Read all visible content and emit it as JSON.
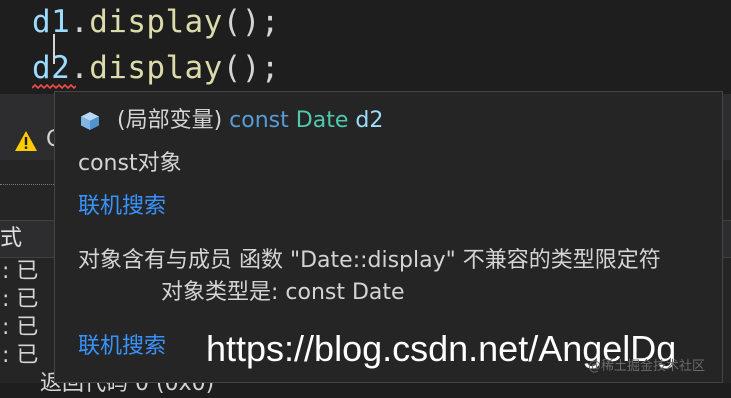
{
  "editor": {
    "line1": {
      "var": "d1",
      "dot": ".",
      "fn": "display",
      "tail": "();"
    },
    "line2": {
      "var": "d2",
      "dot": ".",
      "fn": "display",
      "tail": "();"
    }
  },
  "panel": {
    "warning_text": "C",
    "column_header": "式",
    "output_lines": [
      ": 已",
      ": 已",
      ": 已",
      ": 已"
    ],
    "bottom_line": "返回代码 0 (0x0)"
  },
  "tooltip": {
    "icon": "field-variable-icon",
    "signature": {
      "prefix": "(局部变量)",
      "keyword": "const",
      "type": "Date",
      "name": "d2"
    },
    "description": "const对象",
    "link1": "联机搜索",
    "error_line1": "对象含有与成员 函数 \"Date::display\" 不兼容的类型限定符",
    "error_line2": "对象类型是:  const Date",
    "link2": "联机搜索"
  },
  "watermark": {
    "url": "https://blog.csdn.net/AngelDg",
    "small": "@稀土掘金技术社区"
  },
  "colors": {
    "background": "#1e1e1e",
    "tooltip_bg": "#252526",
    "link": "#3794ff",
    "keyword": "#569cd6",
    "type": "#4ec9b0",
    "variable": "#9cdcfe",
    "function": "#dcdcaa",
    "error_squiggle": "#f14c4c",
    "warning": "#ffcc00"
  }
}
